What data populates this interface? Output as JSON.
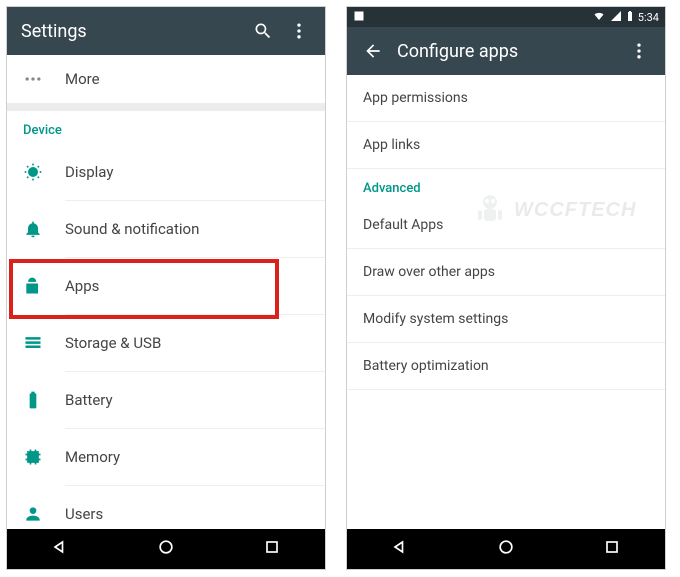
{
  "left": {
    "appbar_title": "Settings",
    "more_label": "More",
    "section_device": "Device",
    "items": {
      "display": "Display",
      "sound": "Sound & notification",
      "apps": "Apps",
      "storage": "Storage & USB",
      "battery": "Battery",
      "memory": "Memory",
      "users": "Users"
    }
  },
  "right": {
    "status_time": "5:34",
    "appbar_title": "Configure apps",
    "items": {
      "app_permissions": "App permissions",
      "app_links": "App links",
      "advanced": "Advanced",
      "default_apps": "Default Apps",
      "draw_over": "Draw over other apps",
      "modify_system": "Modify system settings",
      "battery_opt": "Battery optimization"
    }
  },
  "watermark": "WCCFTECH"
}
